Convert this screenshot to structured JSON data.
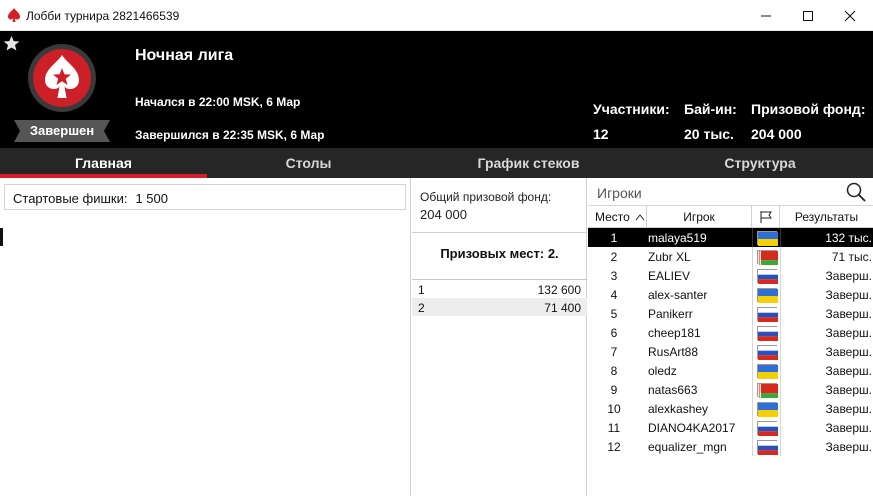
{
  "window": {
    "title": "Лобби турнира 2821466539"
  },
  "header": {
    "tournament_name": "Ночная лига",
    "started": "Начался в 22:00 MSK, 6 Мар",
    "finished": "Завершился в 22:35 MSK, 6 Мар",
    "status": "Завершен",
    "stats": [
      {
        "label": "Участники:",
        "value": "12"
      },
      {
        "label": "Бай-ин:",
        "value": "20 тыс."
      },
      {
        "label": "Призовой фонд:",
        "value": "204 000"
      }
    ]
  },
  "tabs": [
    {
      "label": "Главная",
      "active": true
    },
    {
      "label": "Столы",
      "active": false
    },
    {
      "label": "График стеков",
      "active": false
    },
    {
      "label": "Структура",
      "active": false
    }
  ],
  "main": {
    "starting_chips_label": "Стартовые фишки:",
    "starting_chips_value": "1 500"
  },
  "prize": {
    "pool_label": "Общий призовой фонд:",
    "pool_value": "204 000",
    "places_title": "Призовых мест: 2.",
    "payouts": [
      {
        "place": "1",
        "amount": "132 600"
      },
      {
        "place": "2",
        "amount": "71 400"
      }
    ]
  },
  "players": {
    "search_placeholder": "Игроки",
    "columns": {
      "place": "Место",
      "player": "Игрок",
      "results": "Результаты"
    },
    "rows": [
      {
        "place": "1",
        "name": "malaya519",
        "flag": "ua",
        "result": "132 тыс."
      },
      {
        "place": "2",
        "name": "Zubr XL",
        "flag": "by",
        "result": "71 тыс."
      },
      {
        "place": "3",
        "name": "EALIEV",
        "flag": "ru",
        "result": "Заверш."
      },
      {
        "place": "4",
        "name": "alex-santer",
        "flag": "ua",
        "result": "Заверш."
      },
      {
        "place": "5",
        "name": "Panikerr",
        "flag": "ru",
        "result": "Заверш."
      },
      {
        "place": "6",
        "name": "cheep181",
        "flag": "ru",
        "result": "Заверш."
      },
      {
        "place": "7",
        "name": "RusArt88",
        "flag": "ru",
        "result": "Заверш."
      },
      {
        "place": "8",
        "name": "oledz",
        "flag": "ua",
        "result": "Заверш."
      },
      {
        "place": "9",
        "name": "natas663",
        "flag": "by",
        "result": "Заверш."
      },
      {
        "place": "10",
        "name": "alexkashey",
        "flag": "ua",
        "result": "Заверш."
      },
      {
        "place": "11",
        "name": "DIANO4KA2017",
        "flag": "ru",
        "result": "Заверш."
      },
      {
        "place": "12",
        "name": "equalizer_mgn",
        "flag": "ru",
        "result": "Заверш."
      }
    ],
    "selected_index": 0
  },
  "colors": {
    "accent_red": "#d4202a",
    "header_bg": "#000000",
    "tab_bg": "#262626"
  }
}
